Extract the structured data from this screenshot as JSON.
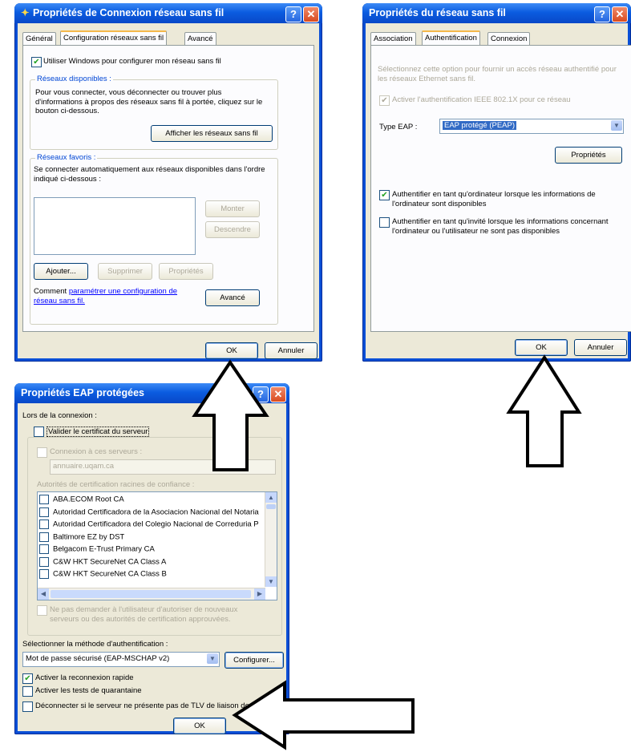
{
  "win1": {
    "title": "Propriétés de Connexion réseau sans fil",
    "title_icon": "wireless-icon",
    "tabs": [
      "Général",
      "Configuration réseaux sans fil",
      "Avancé"
    ],
    "use_windows_label": "Utiliser Windows pour configurer mon réseau sans fil",
    "available_legend": "Réseaux disponibles :",
    "available_text": "Pour vous connecter, vous déconnecter ou trouver plus d'informations à propos des réseaux sans fil à portée, cliquez sur le bouton ci-dessous.",
    "show_networks_button": "Afficher les réseaux sans fil",
    "favorites_legend": "Réseaux favoris :",
    "favorites_text": "Se connecter automatiquement aux réseaux disponibles dans l'ordre indiqué ci-dessous :",
    "up_button": "Monter",
    "down_button": "Descendre",
    "add_button": "Ajouter...",
    "remove_button": "Supprimer",
    "properties_button": "Propriétés",
    "help_text_prefix": "Comment",
    "help_link": "paramétrer une configuration de réseau sans fil.",
    "advanced_button": "Avancé",
    "ok_button": "OK",
    "cancel_button": "Annuler"
  },
  "win2": {
    "title": "Propriétés du réseau sans fil",
    "tabs": [
      "Association",
      "Authentification",
      "Connexion"
    ],
    "info_text": "Sélectionnez cette option pour fournir un accès réseau authentifié pour les réseaux Ethernet sans fil.",
    "ieee_label": "Activer l'authentification IEEE 802.1X pour ce réseau",
    "eap_type_label": "Type EAP :",
    "eap_type_value": "EAP protégé (PEAP)",
    "properties_button": "Propriétés",
    "auth_computer_label": "Authentifier en tant qu'ordinateur lorsque les informations de l'ordinateur sont disponibles",
    "auth_guest_label": "Authentifier en tant qu'invité lorsque les informations concernant l'ordinateur ou l'utilisateur ne sont pas disponibles",
    "ok_button": "OK",
    "cancel_button": "Annuler"
  },
  "win3": {
    "title": "Propriétés EAP protégées",
    "on_connect_label": "Lors de la connexion :",
    "validate_cert_label": "Valider le certificat du serveur",
    "connect_servers_label": "Connexion à ces serveurs :",
    "server_value": "annuaire.uqam.ca",
    "root_ca_label": "Autorités de certification racines de confiance :",
    "ca_items": [
      "ABA.ECOM Root CA",
      "Autoridad Certificadora de la Asociacion Nacional del Notaria",
      "Autoridad Certificadora del Colegio Nacional de Correduria P",
      "Baltimore EZ by DST",
      "Belgacom E-Trust Primary CA",
      "C&W HKT SecureNet CA Class A",
      "C&W HKT SecureNet CA Class B"
    ],
    "no_prompt_label": "Ne pas demander à l'utilisateur d'autoriser de nouveaux serveurs ou des autorités de certification approuvées.",
    "select_method_label": "Sélectionner la méthode d'authentification :",
    "method_value": "Mot de passe sécurisé (EAP-MSCHAP v2)",
    "configure_button": "Configurer...",
    "fast_reconnect_label": "Activer la reconnexion rapide",
    "quarantine_label": "Activer les tests de quarantaine",
    "disconnect_label": "Déconnecter si le serveur ne présente pas de TLV de liaison de c",
    "ok_button": "OK"
  },
  "colors": {
    "title_blue": "#0b5ce0",
    "face": "#ece9d8",
    "panel": "#fcfcfe",
    "close_red": "#d94a1f",
    "check_green": "#21a121"
  }
}
